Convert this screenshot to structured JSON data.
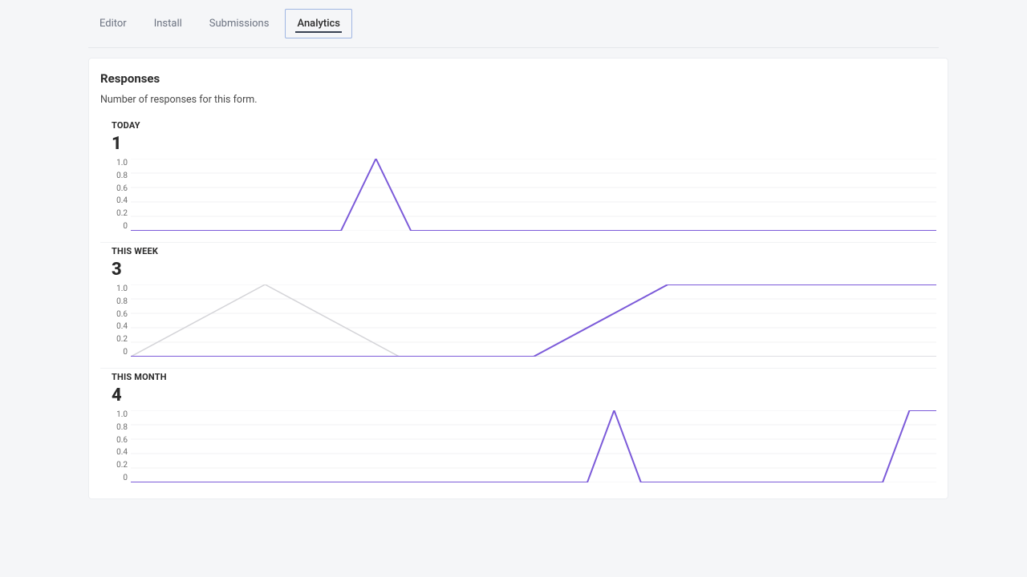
{
  "tabs": [
    {
      "label": "Editor"
    },
    {
      "label": "Install"
    },
    {
      "label": "Submissions"
    },
    {
      "label": "Analytics",
      "active": true
    }
  ],
  "card": {
    "title": "Responses",
    "subtitle": "Number of responses for this form."
  },
  "colors": {
    "primary": "#7c5bd9",
    "secondary": "#d4d4d8"
  },
  "y_ticks": [
    "1.0",
    "0.8",
    "0.6",
    "0.4",
    "0.2",
    "0"
  ],
  "chart_data": [
    {
      "type": "line",
      "label": "TODAY",
      "total": "1",
      "ylim": [
        0,
        1
      ],
      "count": 24,
      "series": [
        {
          "name": "primary",
          "values": [
            0,
            0,
            0,
            0,
            0,
            0,
            0,
            1,
            0,
            0,
            0,
            0,
            0,
            0,
            0,
            0,
            0,
            0,
            0,
            0,
            0,
            0,
            0,
            0
          ]
        }
      ]
    },
    {
      "type": "line",
      "label": "THIS WEEK",
      "total": "3",
      "ylim": [
        0,
        1
      ],
      "count": 7,
      "series": [
        {
          "name": "secondary",
          "values": [
            0,
            1,
            0,
            0,
            0,
            0,
            0
          ]
        },
        {
          "name": "primary",
          "values": [
            0,
            0,
            0,
            0,
            1,
            1,
            1
          ]
        }
      ]
    },
    {
      "type": "line",
      "label": "THIS MONTH",
      "total": "4",
      "ylim": [
        0,
        1
      ],
      "count": 31,
      "series": [
        {
          "name": "primary",
          "values": [
            0,
            0,
            0,
            0,
            0,
            0,
            0,
            0,
            0,
            0,
            0,
            0,
            0,
            0,
            0,
            0,
            0,
            0,
            1,
            0,
            0,
            0,
            0,
            0,
            0,
            0,
            0,
            0,
            0,
            1,
            1
          ]
        }
      ]
    }
  ]
}
